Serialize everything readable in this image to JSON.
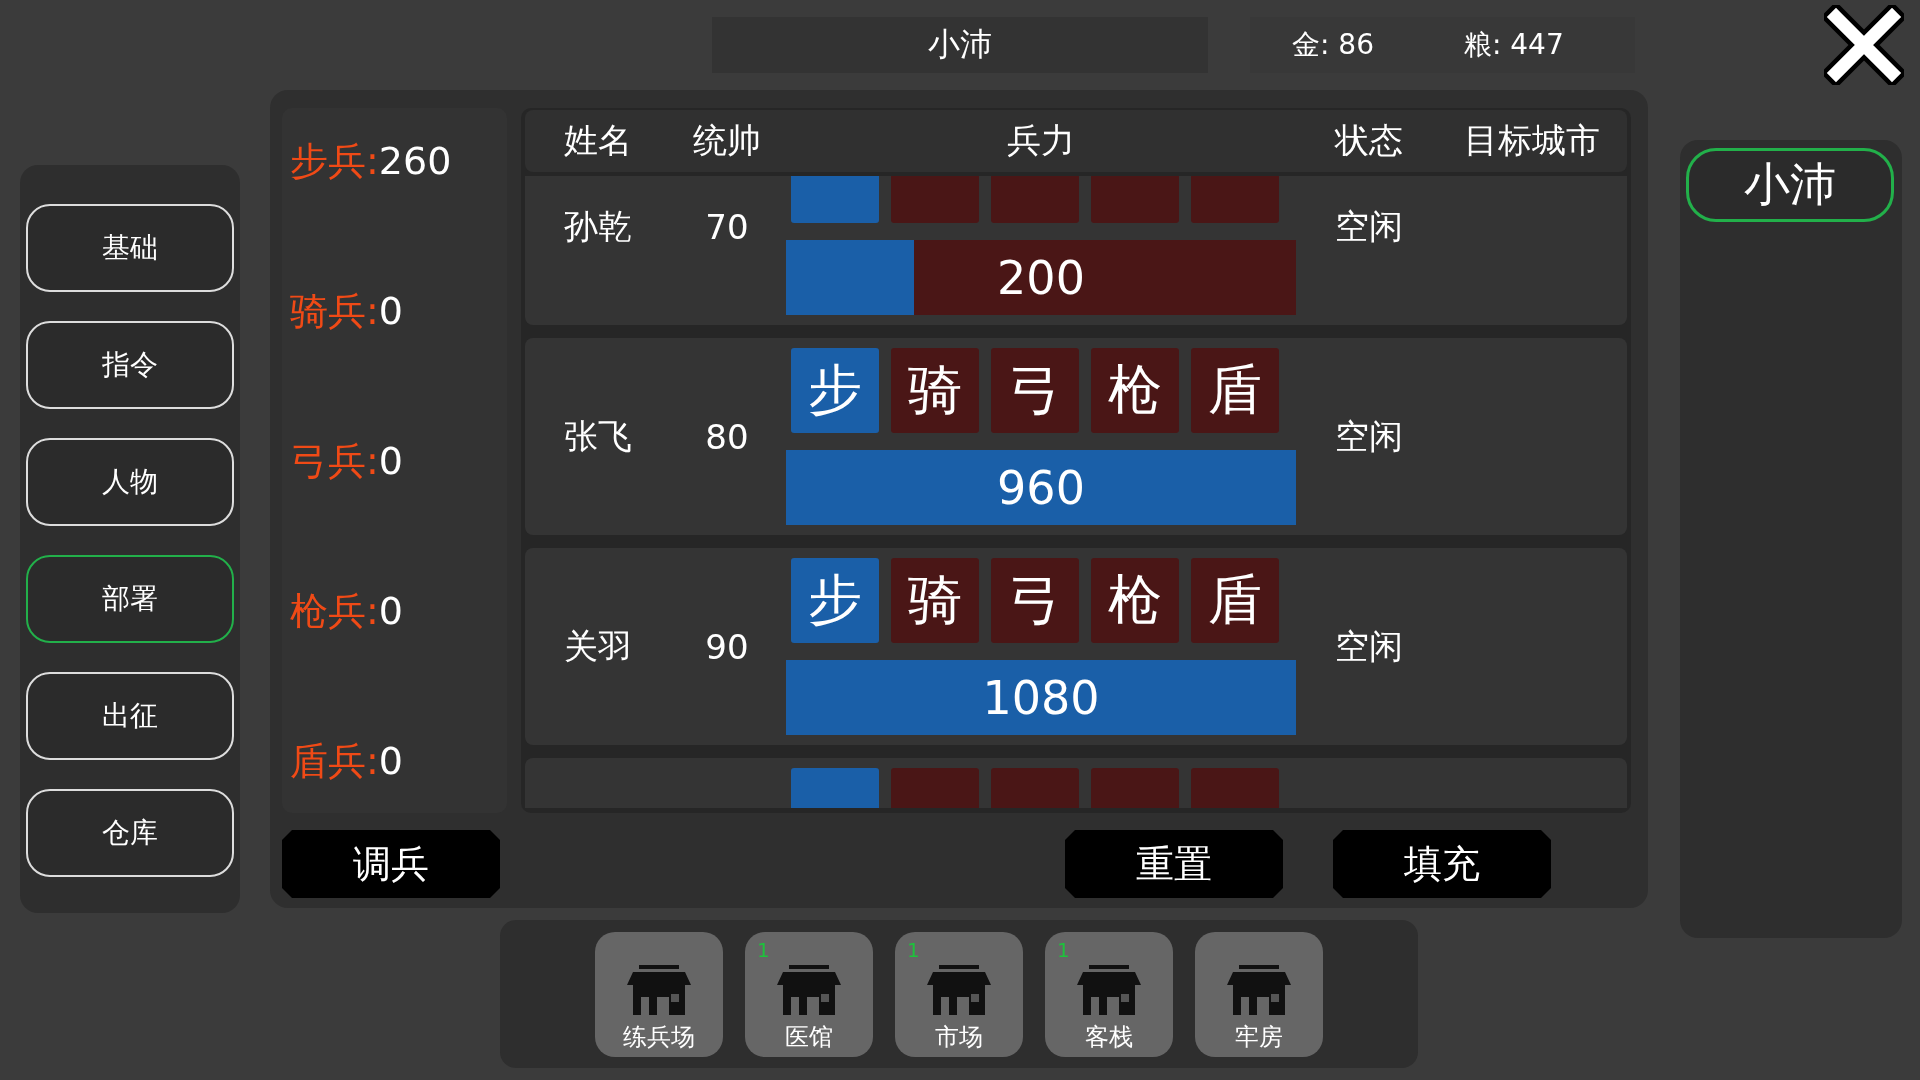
{
  "header": {
    "city": "小沛",
    "gold": "金: 86",
    "grain": "粮: 447"
  },
  "nav": [
    {
      "label": "基础",
      "selected": false
    },
    {
      "label": "指令",
      "selected": false
    },
    {
      "label": "人物",
      "selected": false
    },
    {
      "label": "部署",
      "selected": true
    },
    {
      "label": "出征",
      "selected": false
    },
    {
      "label": "仓库",
      "selected": false
    }
  ],
  "troop_counts": [
    {
      "label": "步兵:",
      "value": "260"
    },
    {
      "label": "骑兵:",
      "value": "0"
    },
    {
      "label": "弓兵:",
      "value": "0"
    },
    {
      "label": "枪兵:",
      "value": "0"
    },
    {
      "label": "盾兵:",
      "value": "0"
    }
  ],
  "table": {
    "columns": [
      "姓名",
      "统帅",
      "兵力",
      "状态",
      "目标城市"
    ],
    "rows": [
      {
        "name": "孙乾",
        "command": "70",
        "status": "空闲",
        "troops": "200",
        "level": 0.25,
        "types": [
          {
            "selected": true
          },
          {
            "selected": false
          },
          {
            "selected": false
          },
          {
            "selected": false
          },
          {
            "selected": false
          }
        ]
      },
      {
        "name": "张飞",
        "command": "80",
        "status": "空闲",
        "troops": "960",
        "level": 1,
        "types": [
          {
            "label": "步",
            "selected": true
          },
          {
            "label": "骑",
            "selected": false
          },
          {
            "label": "弓",
            "selected": false
          },
          {
            "label": "枪",
            "selected": false
          },
          {
            "label": "盾",
            "selected": false
          }
        ]
      },
      {
        "name": "关羽",
        "command": "90",
        "status": "空闲",
        "troops": "1080",
        "level": 1,
        "types": [
          {
            "label": "步",
            "selected": true
          },
          {
            "label": "骑",
            "selected": false
          },
          {
            "label": "弓",
            "selected": false
          },
          {
            "label": "枪",
            "selected": false
          },
          {
            "label": "盾",
            "selected": false
          }
        ]
      },
      {
        "types": [
          {
            "selected": true
          },
          {
            "selected": false
          },
          {
            "selected": false
          },
          {
            "selected": false
          },
          {
            "selected": false
          }
        ]
      }
    ]
  },
  "actions": {
    "left": "调兵",
    "right": [
      "重置",
      "填充"
    ]
  },
  "cities": [
    {
      "label": "小沛",
      "selected": true
    }
  ],
  "buildings": [
    {
      "label": "练兵场"
    },
    {
      "label": "医馆",
      "badge": "1"
    },
    {
      "label": "市场",
      "badge": "1"
    },
    {
      "label": "客栈",
      "badge": "1"
    },
    {
      "label": "牢房"
    }
  ]
}
